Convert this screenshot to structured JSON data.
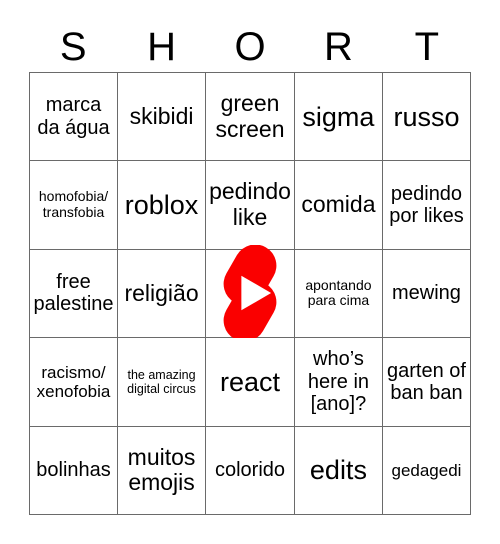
{
  "card": {
    "title": "SHORT",
    "header_letters": [
      "S",
      "H",
      "O",
      "R",
      "T"
    ],
    "free_space_icon": "youtube-shorts-icon",
    "colors": {
      "grid_line": "#6a6a6a",
      "text": "#000000",
      "background": "#ffffff",
      "logo_red": "#fa0000",
      "logo_play": "#ffffff"
    },
    "rows": [
      [
        {
          "text": "marca da água",
          "size": "md"
        },
        {
          "text": "skibidi",
          "size": "lg"
        },
        {
          "text": "green screen",
          "size": "lg"
        },
        {
          "text": "sigma",
          "size": "xl"
        },
        {
          "text": "russo",
          "size": "xl"
        }
      ],
      [
        {
          "text": "homofobia/ transfobia",
          "size": "xs"
        },
        {
          "text": "roblox",
          "size": "xl"
        },
        {
          "text": "pedindo like",
          "size": "lg"
        },
        {
          "text": "comida",
          "size": "lg"
        },
        {
          "text": "pedindo por likes",
          "size": "md"
        }
      ],
      [
        {
          "text": "free palestine",
          "size": "md"
        },
        {
          "text": "religião",
          "size": "lg"
        },
        {
          "text": "",
          "size": "md",
          "free": true
        },
        {
          "text": "apontando para cima",
          "size": "xs"
        },
        {
          "text": "mewing",
          "size": "md"
        }
      ],
      [
        {
          "text": "racismo/ xenofobia",
          "size": "sm"
        },
        {
          "text": "the amazing digital circus",
          "size": "xxs"
        },
        {
          "text": "react",
          "size": "xl"
        },
        {
          "text": "who’s here in [ano]?",
          "size": "md"
        },
        {
          "text": "garten of ban ban",
          "size": "md"
        }
      ],
      [
        {
          "text": "bolinhas",
          "size": "md"
        },
        {
          "text": "muitos emojis",
          "size": "lg"
        },
        {
          "text": "colorido",
          "size": "md"
        },
        {
          "text": "edits",
          "size": "xl"
        },
        {
          "text": "gedagedi",
          "size": "sm"
        }
      ]
    ]
  }
}
